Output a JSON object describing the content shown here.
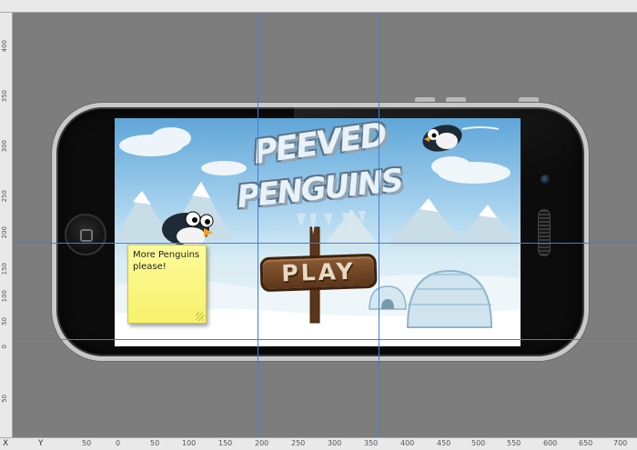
{
  "rulers": {
    "axis_x_letter": "X",
    "axis_y_letter": "Y",
    "bottom_labels": [
      "50",
      "0",
      "50",
      "100",
      "150",
      "200",
      "250",
      "300",
      "350",
      "400",
      "450",
      "500",
      "550",
      "600",
      "650",
      "700"
    ],
    "left_labels": [
      "400",
      "350",
      "300",
      "250",
      "200",
      "150",
      "100",
      "50",
      "0",
      "50"
    ]
  },
  "game": {
    "title_line1": "PEEVED",
    "title_line2": "PENGUINS",
    "play_label": "PLAY"
  },
  "note": {
    "text": "More Penguins please!"
  },
  "colors": {
    "guide": "#3f7fe0",
    "note": "#f9f47a",
    "sign": "#6e4424",
    "canvas": "#7d7d7d"
  }
}
